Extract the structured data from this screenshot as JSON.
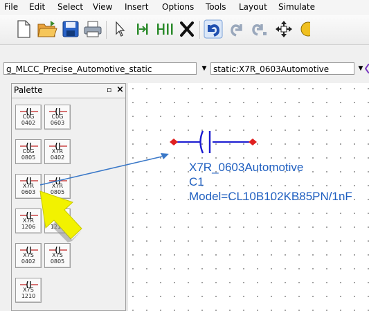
{
  "menu": {
    "items": [
      "File",
      "Edit",
      "Select",
      "View",
      "Insert",
      "Options",
      "Tools",
      "Layout",
      "Simulate"
    ]
  },
  "toolbar": {
    "icons": [
      "new-document-icon",
      "open-folder-icon",
      "save-icon",
      "print-icon",
      "select-pointer-icon",
      "insert-pin-icon",
      "insert-ground-icon",
      "deactivate-icon",
      "undo-icon",
      "redo-icon",
      "redo-last-icon",
      "move-icon"
    ]
  },
  "combos": {
    "library": "g_MLCC_Precise_Automotive_static",
    "component": "static:X7R_0603Automotive"
  },
  "palette": {
    "title": "Palette",
    "items": [
      {
        "line1": "C0G",
        "line2": "0402"
      },
      {
        "line1": "C0G",
        "line2": "0603"
      },
      {
        "line1": "C0G",
        "line2": "0805"
      },
      {
        "line1": "X7R",
        "line2": "0402"
      },
      {
        "line1": "X7R",
        "line2": "0603"
      },
      {
        "line1": "X7R",
        "line2": "0805"
      },
      {
        "line1": "X7R",
        "line2": "1206"
      },
      {
        "line1": "",
        "line2": "1210"
      },
      {
        "line1": "X7S",
        "line2": "0402"
      },
      {
        "line1": "X7S",
        "line2": "0805"
      },
      {
        "line1": "X7S",
        "line2": "1210"
      }
    ]
  },
  "schematic": {
    "component_name": "X7R_0603Automotive",
    "instance": "C1",
    "model": "Model=CL10B102KB85PN/1nF"
  },
  "colors": {
    "annotation": "#1f5fc0",
    "wire": "#1a1ad0",
    "pin": "#e02020",
    "arrow_fill": "#f2f200",
    "drag_line": "#3a78c8"
  }
}
